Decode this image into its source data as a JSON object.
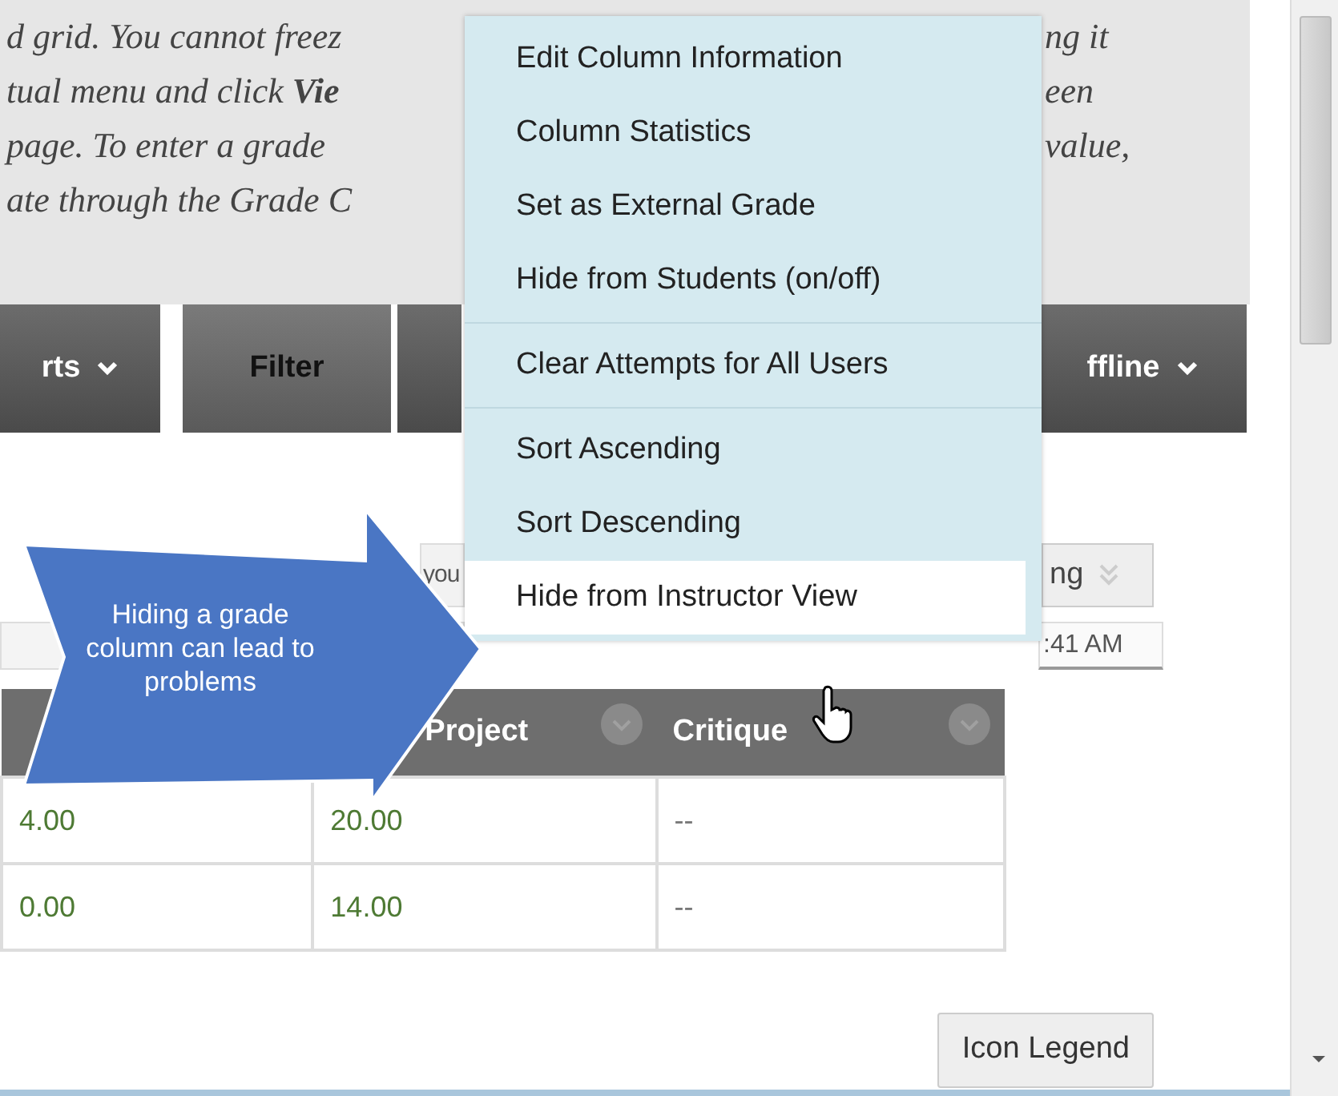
{
  "instructions": {
    "left_lines": [
      "d grid. You cannot freez",
      "tual menu and click **Vie**",
      "page. To enter a grade",
      "ate through the Grade C"
    ],
    "right_lines": [
      "ng it",
      "een",
      "value,"
    ]
  },
  "toolbar": {
    "buttons": [
      {
        "label": "rts",
        "dropdown": true
      },
      {
        "label": "Filter",
        "dropdown": false
      },
      {
        "dropdown": false
      },
      {
        "label": "ffline",
        "dropdown": true
      }
    ]
  },
  "controls": {
    "view_field": "you",
    "sort_button": "ng",
    "time_field": ":41 AM"
  },
  "context_menu": {
    "groups": [
      [
        {
          "label": "Edit Column Information",
          "selected": false
        },
        {
          "label": "Column Statistics",
          "selected": false
        },
        {
          "label": "Set as External Grade",
          "selected": false
        },
        {
          "label": "Hide from Students (on/off)",
          "selected": false
        }
      ],
      [
        {
          "label": "Clear Attempts for All Users",
          "selected": false
        }
      ],
      [
        {
          "label": "Sort Ascending",
          "selected": false
        },
        {
          "label": "Sort Descending",
          "selected": false
        },
        {
          "label": "Hide from Instructor View",
          "selected": true
        }
      ]
    ]
  },
  "callout": {
    "text": "Hiding a grade column can lead to problems"
  },
  "table": {
    "columns": [
      {},
      {
        "label": "Project",
        "menu": true
      },
      {
        "label": "Critique",
        "menu": true
      }
    ],
    "rows": [
      [
        {
          "text": "4.00",
          "graded": true
        },
        {
          "text": "20.00",
          "graded": true
        },
        {
          "text": "--",
          "graded": false
        }
      ],
      [
        {
          "text": "0.00",
          "graded": true
        },
        {
          "text": "14.00",
          "graded": true
        },
        {
          "text": "--",
          "graded": false
        }
      ]
    ]
  },
  "footer": {
    "button": "Icon Legend"
  }
}
